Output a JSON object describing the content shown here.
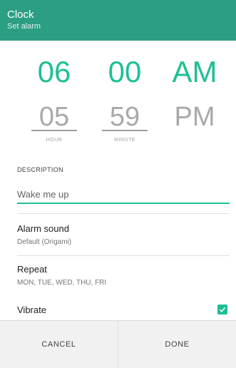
{
  "header": {
    "title": "Clock",
    "subtitle": "Set alarm"
  },
  "picker": {
    "hour": {
      "selected": "06",
      "next": "05",
      "unit": "HOUR"
    },
    "minute": {
      "selected": "00",
      "next": "59",
      "unit": "MINUTE"
    },
    "period": {
      "selected": "AM",
      "next": "PM"
    }
  },
  "description": {
    "label": "DESCRIPTION",
    "value": "Wake me up"
  },
  "alarm_sound": {
    "title": "Alarm sound",
    "value": "Default (Origami)"
  },
  "repeat": {
    "title": "Repeat",
    "value": "MON, TUE, WED, THU, FRI"
  },
  "vibrate": {
    "title": "Vibrate",
    "checked": true
  },
  "actions": {
    "cancel": "CANCEL",
    "done": "DONE"
  },
  "colors": {
    "accent": "#1fbf95",
    "header": "#2c9f82"
  }
}
